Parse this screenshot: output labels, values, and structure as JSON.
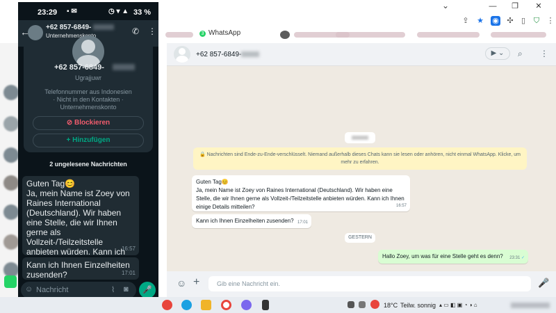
{
  "browser": {
    "bookmark_whatsapp": "WhatsApp",
    "minimize": "—",
    "maximize": "❐",
    "close": "✕",
    "chevron": "⌄"
  },
  "phone": {
    "status": {
      "time": "23:29",
      "battery": "33 %"
    },
    "header": {
      "back_arrow": "←",
      "phone_number": "+62 857-6849-",
      "subtitle": "Unternehmenskonto"
    },
    "profile": {
      "phone_number": "+62 857-6849-",
      "name": "Ugrajjuwr",
      "info_line1": "Telefonnummer aus Indonesien",
      "info_line2": "· Nicht in den Kontakten ·",
      "info_line3": "Unternehmenskonto",
      "block_button": "Blockieren",
      "add_button": "Hinzufügen"
    },
    "unread_banner": "2 ungelesene Nachrichten",
    "messages": [
      {
        "greeting": "Guten Tag",
        "emoji": "😊",
        "text": "Ja, mein Name ist Zoey von Raines International (Deutschland). Wir haben eine Stelle, die wir Ihnen gerne als Vollzeit-/Teilzeitstelle anbieten würden. Kann ich Ihnen einige Details mitteilen?",
        "time": "16:57"
      },
      {
        "text": "Kann ich Ihnen Einzelheiten zusenden?",
        "time": "17:01"
      }
    ],
    "input_placeholder": "Nachricht"
  },
  "wa_web": {
    "header": {
      "phone_number": "+62 857-6849-"
    },
    "system_message": "🔒 Nachrichten sind Ende-zu-Ende-verschlüsselt. Niemand außerhalb dieses Chats kann sie lesen oder anhören, nicht einmal WhatsApp. Klicke, um mehr zu erfahren.",
    "messages": [
      {
        "greeting": "Guten Tag",
        "emoji": "😊",
        "text": "Ja, mein Name ist Zoey von Raines International (Deutschland). Wir haben eine Stelle, die wir Ihnen gerne als Vollzeit-/Teilzeitstelle anbieten würden. Kann ich Ihnen einige Details mitteilen?",
        "time": "16:57"
      },
      {
        "text": "Kann ich Ihnen Einzelheiten zusenden?",
        "time": "17:01"
      }
    ],
    "date_divider": "GESTERN",
    "outgoing": {
      "text": "Hallo Zoey, um was für eine Stelle geht es denn?",
      "time": "23:31",
      "ticks": "✓"
    },
    "input_placeholder": "Gib eine Nachricht ein."
  },
  "taskbar": {
    "weather": "18°C",
    "weather_desc": "Teilw. sonnig"
  }
}
